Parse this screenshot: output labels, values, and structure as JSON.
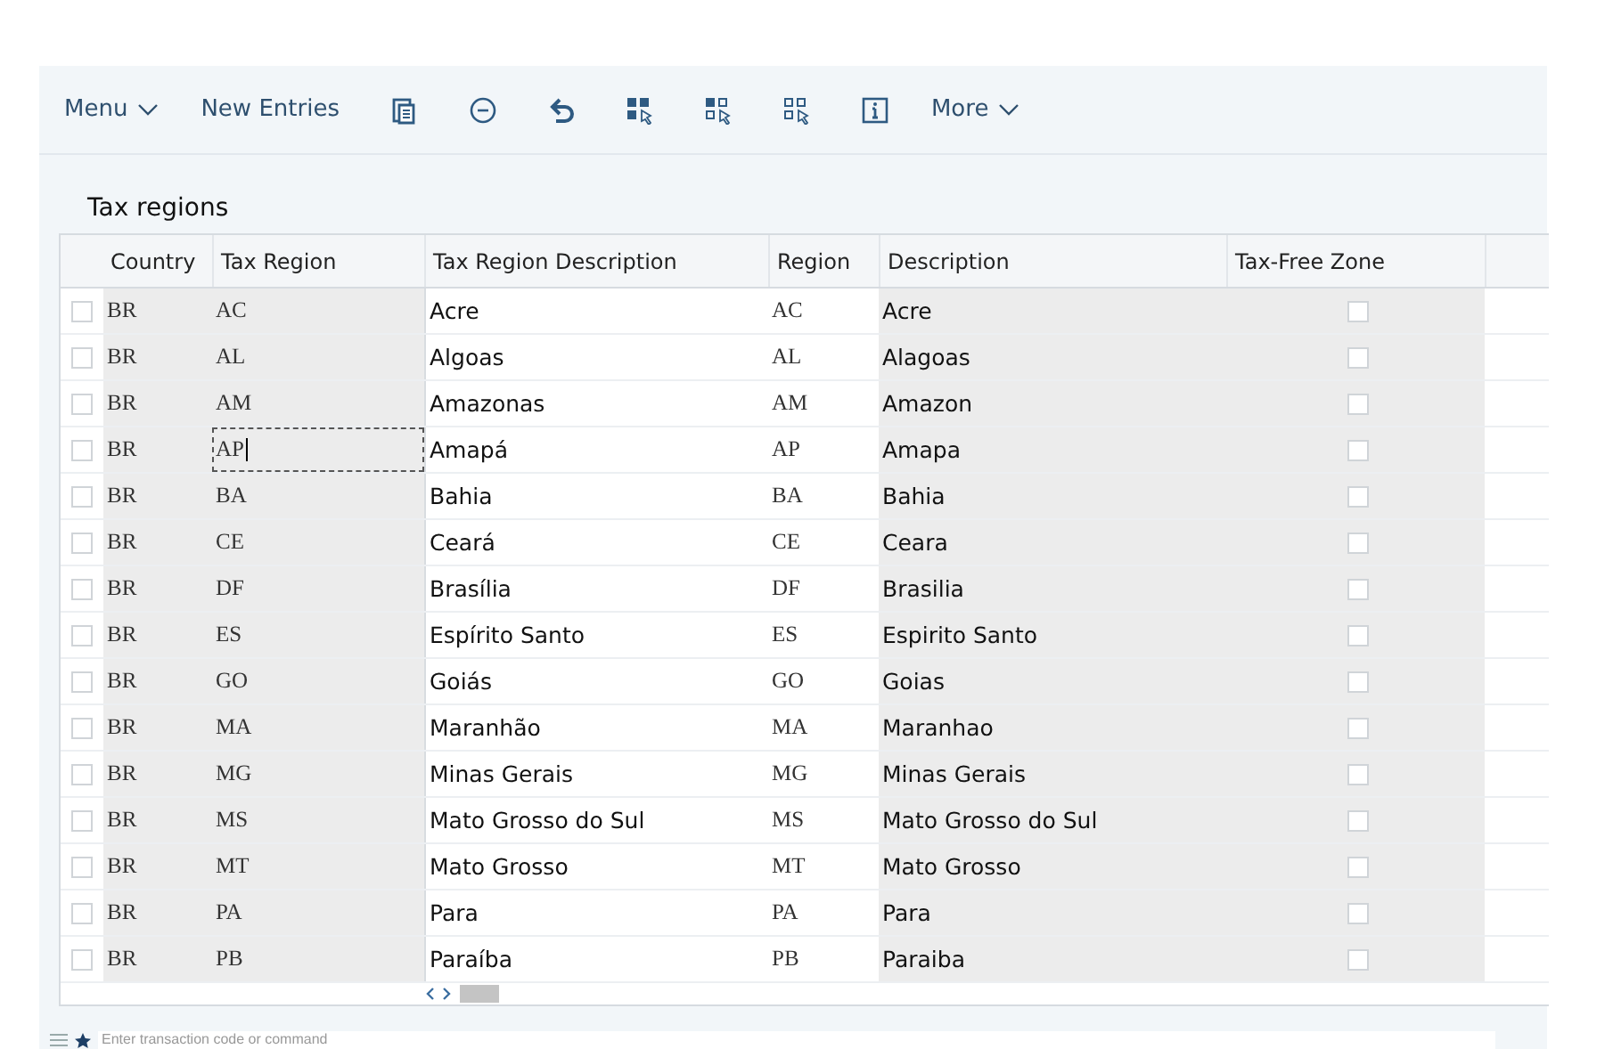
{
  "toolbar": {
    "items": [
      {
        "kind": "menu",
        "label": "Menu"
      },
      {
        "kind": "text",
        "label": "New Entries"
      },
      {
        "kind": "copy"
      },
      {
        "kind": "remove"
      },
      {
        "kind": "undo"
      },
      {
        "kind": "selectall"
      },
      {
        "kind": "selectblock"
      },
      {
        "kind": "deselect"
      },
      {
        "kind": "info"
      },
      {
        "kind": "menu",
        "label": "More"
      }
    ]
  },
  "section_title": "Tax regions",
  "table": {
    "columns": [
      "Country",
      "Tax Region",
      "Tax Region Description",
      "Region",
      "Description",
      "Tax-Free Zone"
    ],
    "rows": [
      {
        "selected": false,
        "country": "BR",
        "tax_region": "AC",
        "tax_region_description": "Acre",
        "region": "AC",
        "description": "Acre",
        "tax_free": false,
        "focused": false
      },
      {
        "selected": false,
        "country": "BR",
        "tax_region": "AL",
        "tax_region_description": "Algoas",
        "region": "AL",
        "description": "Alagoas",
        "tax_free": false,
        "focused": false
      },
      {
        "selected": false,
        "country": "BR",
        "tax_region": "AM",
        "tax_region_description": "Amazonas",
        "region": "AM",
        "description": "Amazon",
        "tax_free": false,
        "focused": false
      },
      {
        "selected": false,
        "country": "BR",
        "tax_region": "AP",
        "tax_region_description": "Amapá",
        "region": "AP",
        "description": "Amapa",
        "tax_free": false,
        "focused": true
      },
      {
        "selected": false,
        "country": "BR",
        "tax_region": "BA",
        "tax_region_description": "Bahia",
        "region": "BA",
        "description": "Bahia",
        "tax_free": false,
        "focused": false
      },
      {
        "selected": false,
        "country": "BR",
        "tax_region": "CE",
        "tax_region_description": "Ceará",
        "region": "CE",
        "description": "Ceara",
        "tax_free": false,
        "focused": false
      },
      {
        "selected": false,
        "country": "BR",
        "tax_region": "DF",
        "tax_region_description": "Brasília",
        "region": "DF",
        "description": "Brasilia",
        "tax_free": false,
        "focused": false
      },
      {
        "selected": false,
        "country": "BR",
        "tax_region": "ES",
        "tax_region_description": "Espírito Santo",
        "region": "ES",
        "description": "Espirito Santo",
        "tax_free": false,
        "focused": false
      },
      {
        "selected": false,
        "country": "BR",
        "tax_region": "GO",
        "tax_region_description": "Goiás",
        "region": "GO",
        "description": "Goias",
        "tax_free": false,
        "focused": false
      },
      {
        "selected": false,
        "country": "BR",
        "tax_region": "MA",
        "tax_region_description": "Maranhão",
        "region": "MA",
        "description": "Maranhao",
        "tax_free": false,
        "focused": false
      },
      {
        "selected": false,
        "country": "BR",
        "tax_region": "MG",
        "tax_region_description": "Minas Gerais",
        "region": "MG",
        "description": "Minas Gerais",
        "tax_free": false,
        "focused": false
      },
      {
        "selected": false,
        "country": "BR",
        "tax_region": "MS",
        "tax_region_description": "Mato Grosso do Sul",
        "region": "MS",
        "description": "Mato Grosso do Sul",
        "tax_free": false,
        "focused": false
      },
      {
        "selected": false,
        "country": "BR",
        "tax_region": "MT",
        "tax_region_description": "Mato Grosso",
        "region": "MT",
        "description": "Mato Grosso",
        "tax_free": false,
        "focused": false
      },
      {
        "selected": false,
        "country": "BR",
        "tax_region": "PA",
        "tax_region_description": "Para",
        "region": "PA",
        "description": "Para",
        "tax_free": false,
        "focused": false
      },
      {
        "selected": false,
        "country": "BR",
        "tax_region": "PB",
        "tax_region_description": "Paraíba",
        "region": "PB",
        "description": "Paraiba",
        "tax_free": false,
        "focused": false
      }
    ]
  },
  "command_field": {
    "placeholder": "Enter transaction code or command"
  }
}
